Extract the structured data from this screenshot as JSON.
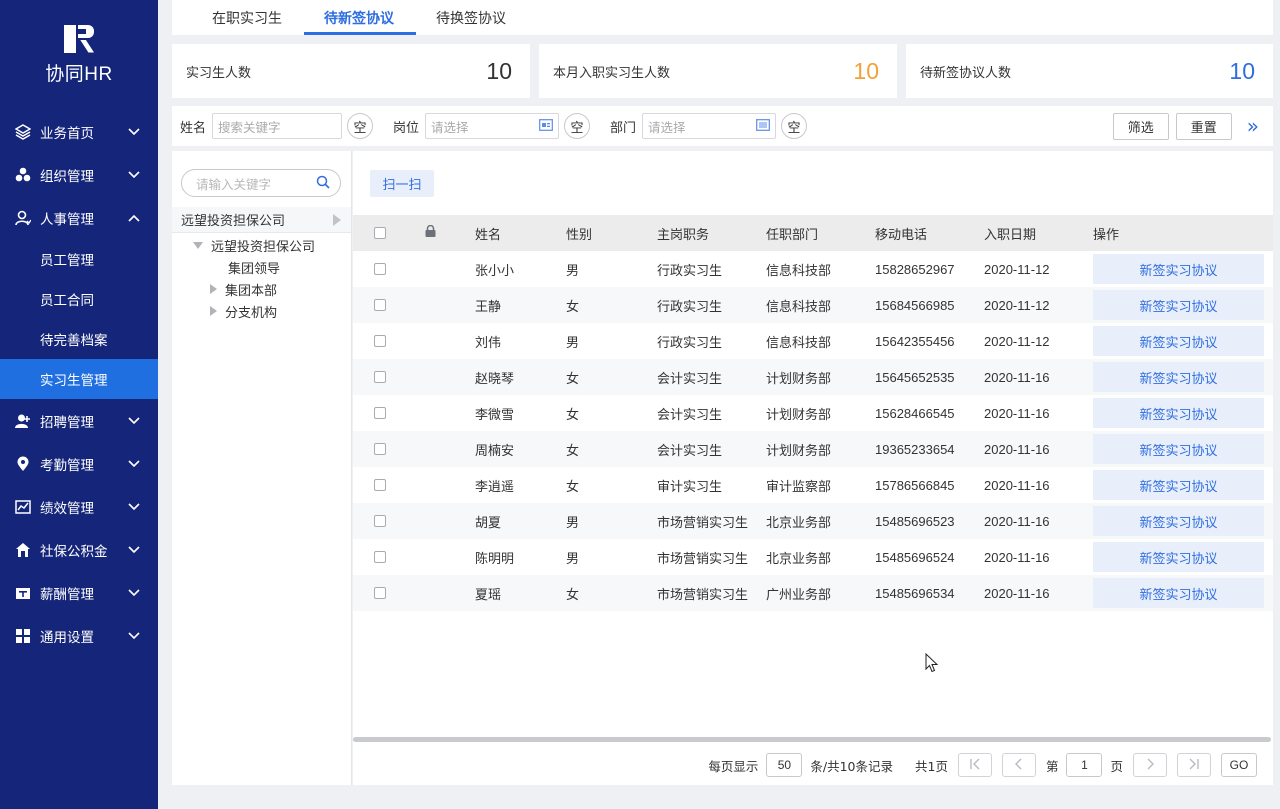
{
  "app": {
    "logo_text": "协同HR"
  },
  "sidebar": {
    "items": [
      {
        "label": "业务首页",
        "icon": "layers-icon"
      },
      {
        "label": "组织管理",
        "icon": "org-icon"
      },
      {
        "label": "人事管理",
        "icon": "user-icon",
        "expanded": true
      },
      {
        "label": "招聘管理",
        "icon": "user-add-icon"
      },
      {
        "label": "考勤管理",
        "icon": "location-icon"
      },
      {
        "label": "绩效管理",
        "icon": "chart-icon"
      },
      {
        "label": "社保公积金",
        "icon": "house-icon"
      },
      {
        "label": "薪酬管理",
        "icon": "wallet-icon"
      },
      {
        "label": "通用设置",
        "icon": "grid-icon"
      }
    ],
    "sub_items": [
      "员工管理",
      "员工合同",
      "待完善档案",
      "实习生管理"
    ],
    "active_sub": "实习生管理"
  },
  "tabs": [
    "在职实习生",
    "待新签协议",
    "待换签协议"
  ],
  "active_tab": "待新签协议",
  "stats": [
    {
      "label": "实习生人数",
      "value": "10",
      "color": "#333333"
    },
    {
      "label": "本月入职实习生人数",
      "value": "10",
      "color": "#f2a13a"
    },
    {
      "label": "待新签协议人数",
      "value": "10",
      "color": "#2f6ee0"
    }
  ],
  "filters": {
    "name_label": "姓名",
    "name_placeholder": "搜索关键字",
    "position_label": "岗位",
    "position_placeholder": "请选择",
    "dept_label": "部门",
    "dept_placeholder": "请选择",
    "clear_label": "空",
    "filter_button": "筛选",
    "reset_button": "重置",
    "expand_glyph": "»"
  },
  "tree": {
    "search_placeholder": "请输入关键字",
    "root": "远望投资担保公司",
    "child": "远望投资担保公司",
    "grandchildren": [
      "集团领导",
      "集团本部",
      "分支机构"
    ]
  },
  "scan_button": "扫一扫",
  "table": {
    "headers": [
      "姓名",
      "性别",
      "主岗职务",
      "任职部门",
      "移动电话",
      "入职日期",
      "操作"
    ],
    "action_label": "新签实习协议",
    "rows": [
      {
        "name": "张小小",
        "sex": "男",
        "position": "行政实习生",
        "dept": "信息科技部",
        "phone": "15828652967",
        "date": "2020-11-12"
      },
      {
        "name": "王静",
        "sex": "女",
        "position": "行政实习生",
        "dept": "信息科技部",
        "phone": "15684566985",
        "date": "2020-11-12"
      },
      {
        "name": "刘伟",
        "sex": "男",
        "position": "行政实习生",
        "dept": "信息科技部",
        "phone": "15642355456",
        "date": "2020-11-12"
      },
      {
        "name": "赵晓琴",
        "sex": "女",
        "position": "会计实习生",
        "dept": "计划财务部",
        "phone": "15645652535",
        "date": "2020-11-16"
      },
      {
        "name": "李微雪",
        "sex": "女",
        "position": "会计实习生",
        "dept": "计划财务部",
        "phone": "15628466545",
        "date": "2020-11-16"
      },
      {
        "name": "周楠安",
        "sex": "女",
        "position": "会计实习生",
        "dept": "计划财务部",
        "phone": "19365233654",
        "date": "2020-11-16"
      },
      {
        "name": "李逍遥",
        "sex": "女",
        "position": "审计实习生",
        "dept": "审计监察部",
        "phone": "15786566845",
        "date": "2020-11-16"
      },
      {
        "name": "胡夏",
        "sex": "男",
        "position": "市场营销实习生",
        "dept": "北京业务部",
        "phone": "15485696523",
        "date": "2020-11-16"
      },
      {
        "name": "陈明明",
        "sex": "男",
        "position": "市场营销实习生",
        "dept": "北京业务部",
        "phone": "15485696524",
        "date": "2020-11-16"
      },
      {
        "name": "夏瑶",
        "sex": "女",
        "position": "市场营销实习生",
        "dept": "广州业务部",
        "phone": "15485696534",
        "date": "2020-11-16"
      }
    ]
  },
  "pagination": {
    "per_page_label": "每页显示",
    "per_page": "50",
    "total_label": "条/共10条记录",
    "pages_label": "共1页",
    "page_prefix": "第",
    "page": "1",
    "page_suffix": "页",
    "go_label": "GO"
  }
}
